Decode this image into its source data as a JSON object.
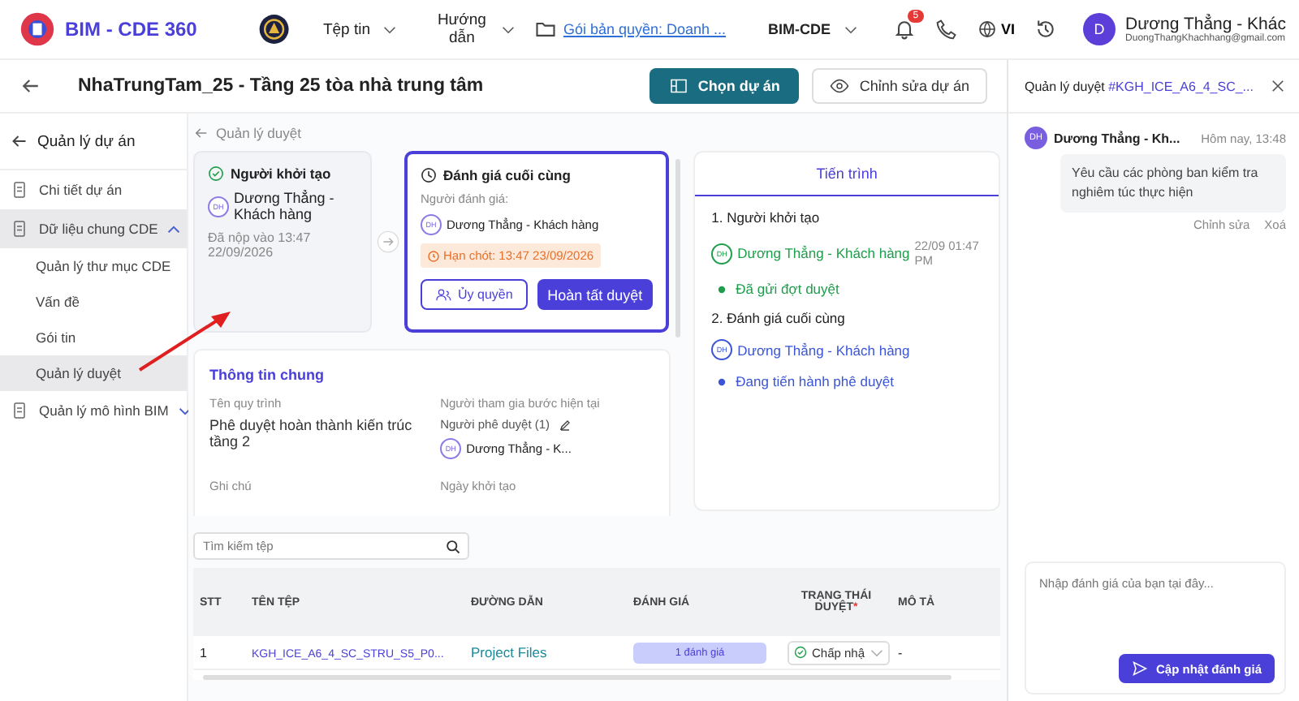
{
  "header": {
    "app_name": "BIM - CDE 360",
    "menus": [
      {
        "label": "Tệp tin"
      },
      {
        "label": "Hướng dẫn"
      }
    ],
    "license_link": "Gói bản quyền: Doanh ...",
    "workspace": "BIM-CDE",
    "notification_count": "5",
    "language": "VI",
    "user": {
      "initial": "D",
      "name": "Dương Thẳng - Khác",
      "email": "DuongThangKhachhang@gmail.com"
    }
  },
  "project_bar": {
    "title": "NhaTrungTam_25 - Tầng 25 tòa nhà trung tâm",
    "primary_button": "Chọn dự án",
    "secondary_button": "Chỉnh sửa dự án"
  },
  "sidebar": {
    "back_label": "Quản lý dự án",
    "items": [
      {
        "label": "Chi tiết dự án",
        "selected": false
      },
      {
        "label": "Dữ liệu chung CDE",
        "selected": true,
        "expanded": true,
        "children": [
          {
            "label": "Quản lý thư mục CDE",
            "selected": false
          },
          {
            "label": "Vấn đề",
            "selected": false
          },
          {
            "label": "Gói tin",
            "selected": false
          },
          {
            "label": "Quản lý duyệt",
            "selected": true
          }
        ]
      },
      {
        "label": "Quản lý mô hình BIM",
        "selected": false,
        "expanded": false
      }
    ]
  },
  "breadcrumb": "Quản lý duyệt",
  "steps": [
    {
      "kind": "done",
      "title": "Người khởi tạo",
      "initials": "DH",
      "person": "Dương Thẳng - Khách hàng",
      "submitted": "Đã nộp vào 13:47 22/09/2026",
      "selected": false
    },
    {
      "kind": "current",
      "title": "Đánh giá cuối cùng",
      "reviewer_label": "Người đánh giá:",
      "initials": "DH",
      "person": "Dương Thẳng - Khách hàng",
      "deadline": "Hạn chót: 13:47 23/09/2026",
      "delegate_button": "Ủy quyền",
      "complete_button": "Hoàn tất duyệt",
      "selected": true
    }
  ],
  "general_info": {
    "title": "Thông tin chung",
    "process_label": "Tên quy trình",
    "process_value": "Phê duyệt hoàn thành kiến trúc tầng 2",
    "participants_label": "Người tham gia bước hiện tại",
    "approver_label": "Người phê duyệt (1)",
    "approver_initials": "DH",
    "approver_name": "Dương Thẳng - K...",
    "note_label": "Ghi chú",
    "created_label": "Ngày khởi tạo"
  },
  "progress": {
    "tab": "Tiến trình",
    "stages": [
      {
        "title": "1. Người khởi tạo",
        "kind": "done",
        "initials": "DH",
        "person": "Dương Thẳng - Khách hàng",
        "time": "22/09 01:47 PM",
        "status": "Đã gửi đợt duyệt"
      },
      {
        "title": "2. Đánh giá cuối cùng",
        "kind": "current",
        "initials": "DH",
        "person": "Dương Thẳng - Khách hàng",
        "status": "Đang tiến hành phê duyệt"
      }
    ]
  },
  "file_search": {
    "placeholder": "Tìm kiếm tệp"
  },
  "table": {
    "columns": [
      {
        "label": "STT"
      },
      {
        "label": "TÊN TỆP"
      },
      {
        "label": "ĐƯỜNG DẪN"
      },
      {
        "label": "ĐÁNH GIÁ"
      },
      {
        "label": "TRẠNG THÁI DUYỆT",
        "required_mark": "*"
      },
      {
        "label": "MÔ TẢ"
      }
    ],
    "rows": [
      {
        "index": "1",
        "file": "KGH_ICE_A6_4_SC_STRU_S5_P0...",
        "path": "Project Files",
        "rating": "1 đánh giá",
        "status": "Chấp nhậ",
        "description": "-"
      }
    ]
  },
  "comment_panel": {
    "title": "Quản lý duyệt",
    "code": "#KGH_ICE_A6_4_SC_...",
    "comments": [
      {
        "initials": "DH",
        "author": "Dương Thẳng - Kh...",
        "time": "Hôm nay, 13:48",
        "text": "Yêu cầu các phòng ban kiểm tra nghiêm túc thực hiện",
        "edit": "Chỉnh sửa",
        "delete": "Xoá"
      }
    ],
    "input_placeholder": "Nhập đánh giá của bạn tại đây...",
    "submit_button": "Cập nhật đánh giá"
  }
}
